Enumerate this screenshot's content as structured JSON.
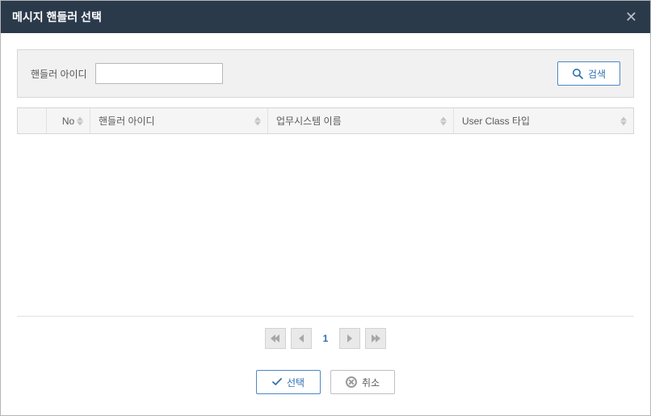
{
  "dialog": {
    "title": "메시지 핸들러 선택"
  },
  "search": {
    "label": "핸들러 아이디",
    "button": "검색"
  },
  "table": {
    "columns": {
      "no": "No",
      "handler_id": "핸들러 아이디",
      "system_name": "업무시스템 이름",
      "user_class_type": "User Class 타입"
    }
  },
  "pager": {
    "current": "1"
  },
  "footer": {
    "select": "선택",
    "cancel": "취소"
  }
}
